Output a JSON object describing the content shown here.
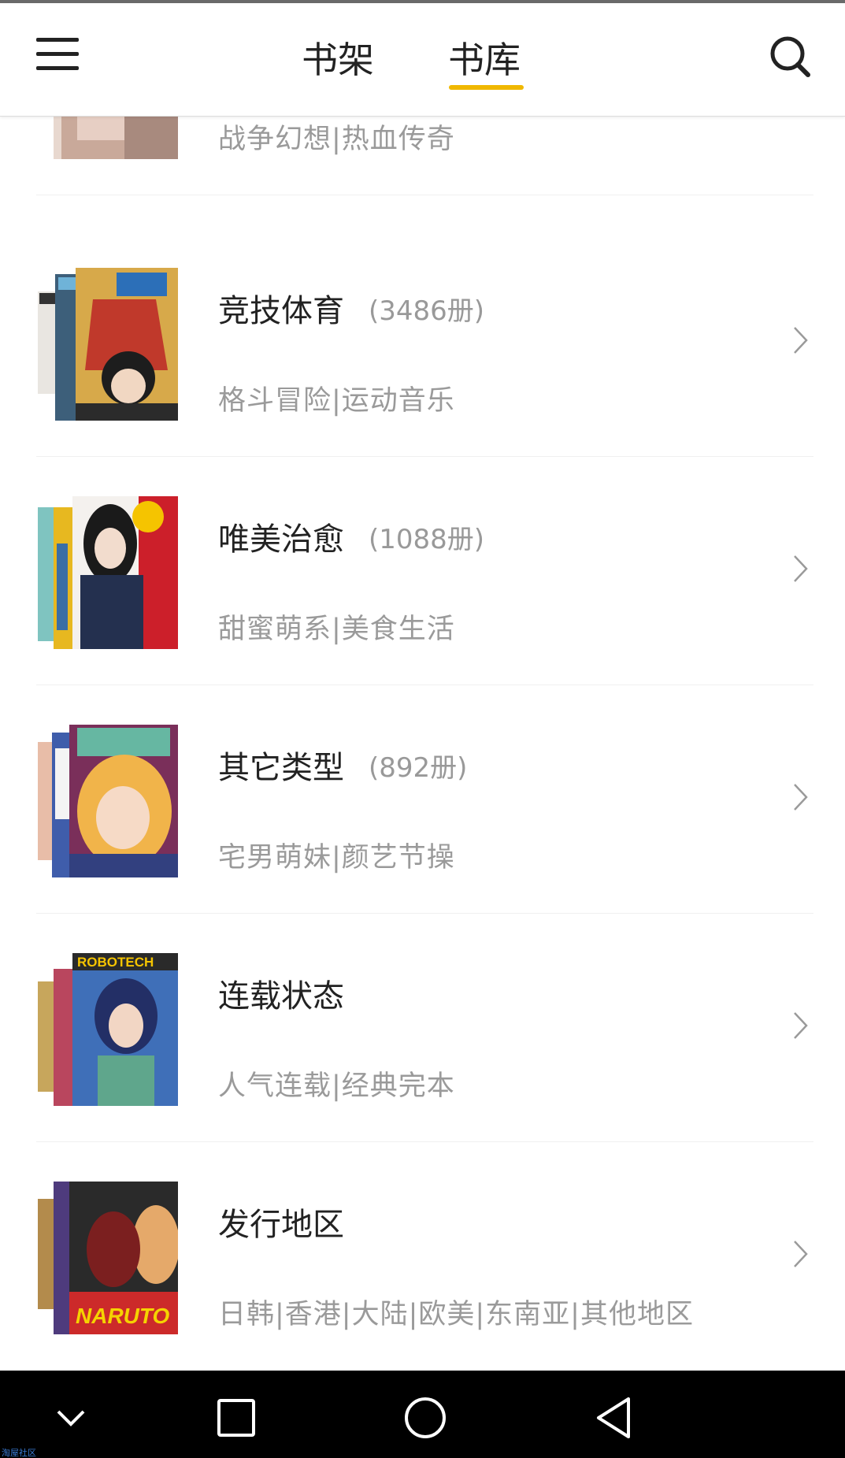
{
  "header": {
    "tabs": [
      {
        "label": "书架",
        "active": false
      },
      {
        "label": "书库",
        "active": true
      }
    ],
    "accent_color": "#f0b800"
  },
  "categories": [
    {
      "title": "",
      "count": "",
      "subtitle": "战争幻想|热血传奇"
    },
    {
      "title": "竞技体育",
      "count": "(3486册)",
      "subtitle": "格斗冒险|运动音乐"
    },
    {
      "title": "唯美治愈",
      "count": "(1088册)",
      "subtitle": "甜蜜萌系|美食生活"
    },
    {
      "title": "其它类型",
      "count": "(892册)",
      "subtitle": "宅男萌妹|颜艺节操"
    },
    {
      "title": "连载状态",
      "count": "",
      "subtitle": "人气连载|经典完本"
    },
    {
      "title": "发行地区",
      "count": "",
      "subtitle": "日韩|香港|大陆|欧美|东南亚|其他地区"
    }
  ],
  "cover_labels": {
    "robotech": "ROBOTECH",
    "naruto": "NARUTO"
  },
  "icons": {
    "menu": "hamburger-icon",
    "search": "search-icon",
    "chevron": "chevron-right-icon",
    "nav_back": "chevron-down-icon",
    "nav_recent": "square-icon",
    "nav_home": "circle-icon",
    "nav_triangle": "triangle-back-icon"
  },
  "watermark": "淘屋社区"
}
